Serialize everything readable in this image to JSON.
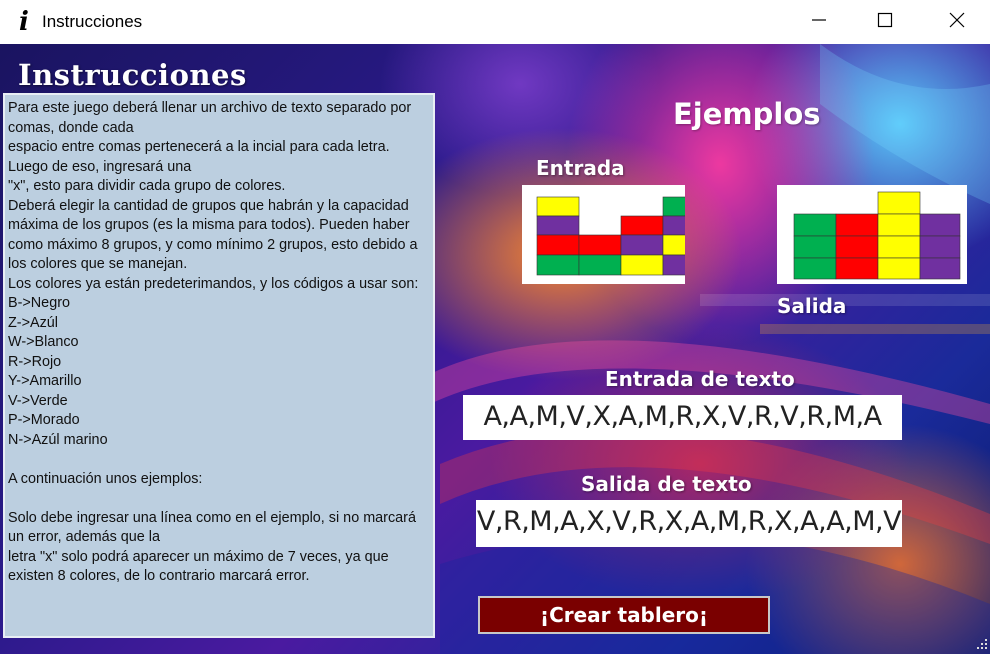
{
  "window": {
    "title": "Instrucciones",
    "app_icon": "info-icon",
    "controls": [
      "minimize-icon",
      "maximize-icon",
      "close-icon"
    ]
  },
  "instructions": {
    "heading": "Instrucciones",
    "text": "Para este juego deberá llenar un archivo de texto separado por comas, donde cada\nespacio entre comas pertenecerá a la incial para cada letra. Luego de eso, ingresará una\n\"x\", esto para dividir cada grupo de colores.\nDeberá elegir la cantidad de grupos que habrán y la capacidad máxima de los grupos (es la misma para todos). Pueden haber como máximo 8 grupos, y como mínimo 2 grupos, esto debido a los colores que se manejan.\nLos colores ya están predeterimandos, y los códigos a usar son:\nB->Negro\nZ->Azúl\nW->Blanco\nR->Rojo\nY->Amarillo\nV->Verde\nP->Morado\nN->Azúl marino\n\nA continuación unos ejemplos:\n\nSolo debe ingresar una línea como en el ejemplo, si no marcará un error, además que la\nletra \"x\" solo podrá aparecer un máximo de 7 veces, ya que existen 8 colores, de lo contrario marcará error."
  },
  "examples": {
    "title": "Ejemplos",
    "input_label": "Entrada",
    "output_label": "Salida",
    "input_text_label": "Entrada de texto",
    "input_text": "A,A,M,V,X,A,M,R,X,V,R,V,R,M,A",
    "output_text_label": "Salida de texto",
    "output_text": "V,R,M,A,X,V,R,X,A,M,R,X,A,A,M,V"
  },
  "actions": {
    "create_board": "¡Crear tablero¡"
  },
  "colors": {
    "yellow": "#ffff00",
    "purple": "#7030a0",
    "red": "#ff0000",
    "green": "#00b050",
    "button_bg": "#7a0000",
    "panel_bg": "#bccfe0"
  }
}
